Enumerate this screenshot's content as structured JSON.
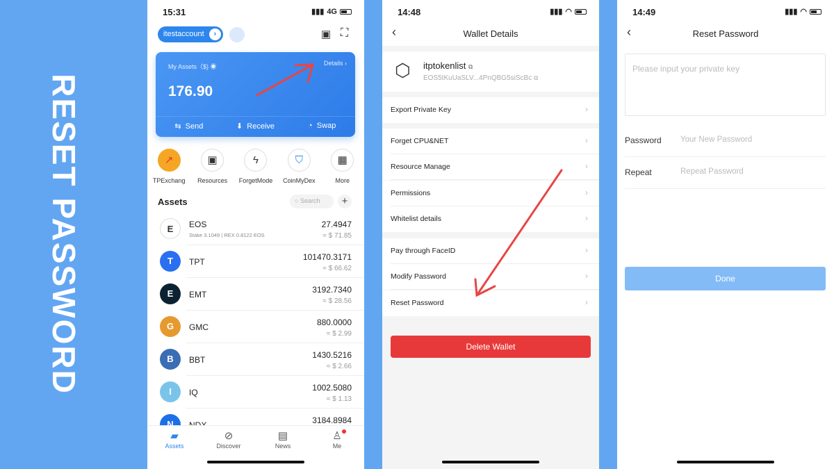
{
  "side_title": "RESET PASSWORD",
  "screen1": {
    "time": "15:31",
    "network": "4G",
    "account": "itestaccount",
    "card": {
      "label": "My Assets（$)",
      "details": "Details",
      "amount": "176.90",
      "send": "Send",
      "receive": "Receive",
      "swap": "Swap"
    },
    "shortcuts": [
      {
        "label": "TPExchang",
        "icon": "tpexchange-icon"
      },
      {
        "label": "Resources",
        "icon": "chip-icon"
      },
      {
        "label": "ForgetModе",
        "icon": "lightning-icon"
      },
      {
        "label": "CoinMyDex",
        "icon": "shield-icon"
      },
      {
        "label": "More",
        "icon": "grid-icon"
      }
    ],
    "assets_title": "Assets",
    "search_placeholder": "Search",
    "assets": [
      {
        "name": "EOS",
        "sub": "Stake 3.1049  |  REX 0.8122 EOS",
        "balance": "27.4947",
        "usd": "≈ $ 71.85",
        "color": "#ffffff"
      },
      {
        "name": "TPT",
        "sub": "",
        "balance": "101470.3171",
        "usd": "≈ $ 66.62",
        "color": "#2a6ff0"
      },
      {
        "name": "EMT",
        "sub": "",
        "balance": "3192.7340",
        "usd": "≈ $ 28.56",
        "color": "#0c2233"
      },
      {
        "name": "GMC",
        "sub": "",
        "balance": "880.0000",
        "usd": "≈ $ 2.99",
        "color": "#e69a2e"
      },
      {
        "name": "BBT",
        "sub": "",
        "balance": "1430.5216",
        "usd": "≈ $ 2.66",
        "color": "#3b6db5"
      },
      {
        "name": "IQ",
        "sub": "",
        "balance": "1002.5080",
        "usd": "≈ $ 1.13",
        "color": "#7ac4ea"
      },
      {
        "name": "NDX",
        "sub": "",
        "balance": "3184.8984",
        "usd": "",
        "color": "#1d6fe8"
      }
    ],
    "tabs": [
      "Assets",
      "Discover",
      "News",
      "Me"
    ]
  },
  "screen2": {
    "time": "14:48",
    "title": "Wallet Details",
    "wallet_name": "itptokenlist",
    "wallet_key": "EOS5tKuUaSLV...4PnQBG5siScBc",
    "items": [
      "Export Private Key",
      "Forget CPU&NET",
      "Resource Manage",
      "Permissions",
      "Whitelist details",
      "Pay through FaceID",
      "Modify Password",
      "Reset Password"
    ],
    "delete": "Delete Wallet"
  },
  "screen3": {
    "time": "14:49",
    "title": "Reset Password",
    "private_key_placeholder": "Please input your private key",
    "password_label": "Password",
    "password_placeholder": "Your New Password",
    "repeat_label": "Repeat",
    "repeat_placeholder": "Repeat Password",
    "done": "Done"
  },
  "colors": {
    "background": "#62a6f2",
    "accent": "#2d86ec",
    "danger": "#e8393a",
    "arrow": "#e84545"
  }
}
